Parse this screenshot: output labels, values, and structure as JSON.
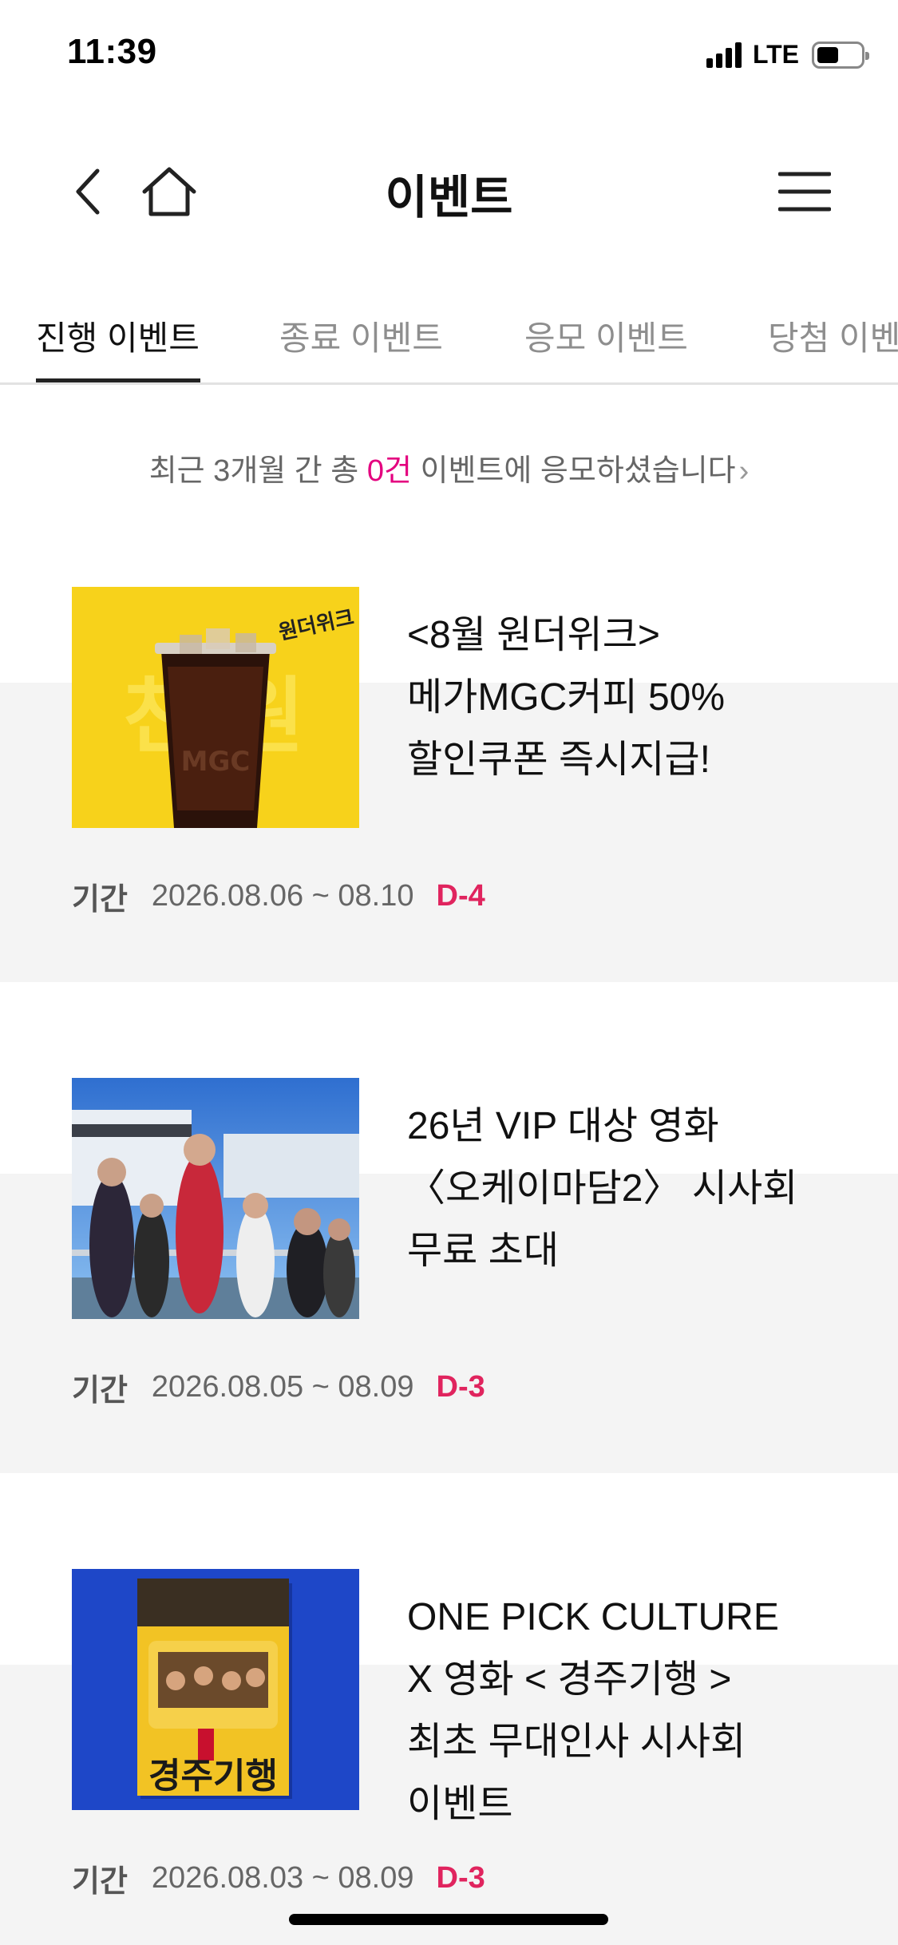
{
  "status_bar": {
    "time": "11:39",
    "network": "LTE",
    "icons": [
      "signal-icon",
      "battery-icon"
    ]
  },
  "header": {
    "title": "이벤트",
    "icons": [
      "back-arrow-icon",
      "home-icon",
      "hamburger-menu-icon"
    ]
  },
  "tabs": [
    {
      "label": "진행 이벤트",
      "active": true
    },
    {
      "label": "종료 이벤트",
      "active": false
    },
    {
      "label": "응모 이벤트",
      "active": false
    },
    {
      "label": "당첨 이벤트",
      "active": false
    }
  ],
  "summary": {
    "prefix": "최근 3개월 간 총 ",
    "count": "0건",
    "suffix": " 이벤트에 응모하셨습니다",
    "chevron": "›"
  },
  "events": [
    {
      "title": "<8월 원더위크>\n메가MGC커피 50%\n할인쿠폰 즉시지급!",
      "period_label": "기간",
      "period": "2026.08.06 ~ 08.10",
      "dday": "D-4",
      "thumb_badge": "원더위크",
      "thumb_text": "천 원"
    },
    {
      "title": "26년 VIP 대상 영화\n〈오케이마담2〉 시사회\n무료 초대",
      "period_label": "기간",
      "period": "2026.08.05 ~ 08.09",
      "dday": "D-3"
    },
    {
      "title": "ONE PICK CULTURE\nX 영화  < 경주기행 >\n최초 무대인사 시사회\n이벤트",
      "period_label": "기간",
      "period": "2026.08.03 ~ 08.09",
      "dday": "D-3",
      "thumb_text": "경주기행"
    }
  ],
  "colors": {
    "accent_pink": "#e4007f",
    "dday_red": "#e0245e",
    "card_bg": "#f4f4f4"
  }
}
